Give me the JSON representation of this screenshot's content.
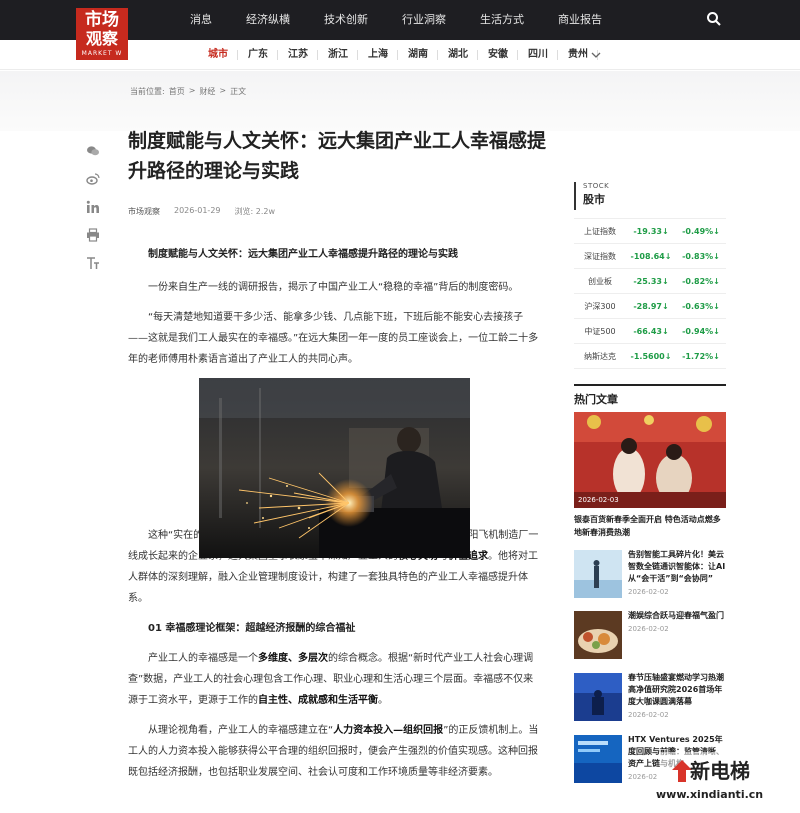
{
  "logo": {
    "line1": "市场",
    "line2": "观察",
    "line3": "MARKET W"
  },
  "topnav": [
    "消息",
    "经济纵横",
    "技术创新",
    "行业洞察",
    "生活方式",
    "商业报告"
  ],
  "cities": [
    "城市",
    "广东",
    "江苏",
    "浙江",
    "上海",
    "湖南",
    "湖北",
    "安徽",
    "四川",
    "贵州"
  ],
  "breadcrumb": {
    "prefix": "当前位置:",
    "home": "首页",
    "sep1": ">",
    "category": "财经",
    "sep2": ">",
    "current": "正文"
  },
  "article": {
    "title": "制度赋能与人文关怀：远大集团产业工人幸福感提升路径的理论与实践",
    "source": "市场观察",
    "date": "2026-01-29",
    "views": "浏览: 2.2w",
    "lead": "制度赋能与人文关怀：远大集团产业工人幸福感提升路径的理论与实践",
    "p1": "一份来自生产一线的调研报告，揭示了中国产业工人“稳稳的幸福”背后的制度密码。",
    "p2": "“每天清楚地知道要干多少活、能拿多少钱、几点能下班，下班后能不能安心去接孩子——这就是我们工人最实在的幸福感。”在远大集团一年一度的员工座谈会上，一位工龄二十多年的老师傅用朴素语言道出了产业工人的共同心声。",
    "p3_a": "这种“实在的幸福”，正是远大集团数千名产业工人的真实写照。作为从沈阳飞机制造厂一线成长起来的企业家，远大集团董事长康宝华深知产业工人的",
    "p3_b": "核心关切",
    "p3_c": "与",
    "p3_d": "价值追求",
    "p3_e": "。他将对工人群体的深刻理解，融入企业管理制度设计，构建了一套独具特色的产业工人幸福感提升体系。",
    "sub1": "01 幸福感理论框架：超越经济报酬的综合福祉",
    "p4_a": "产业工人的幸福感是一个",
    "p4_b": "多维度、多层次",
    "p4_c": "的综合概念。根据“新时代产业工人社会心理调查”数据，产业工人的社会心理包含工作心理、职业心理和生活心理三个层面。幸福感不仅来源于工资水平，更源于工作的",
    "p4_d": "自主性、成就感和生活平衡",
    "p4_e": "。",
    "p5_a": "从理论视角看，产业工人的幸福感建立在“",
    "p5_b": "人力资本投入—组织回报",
    "p5_c": "”的正反馈机制上。当工人的人力资本投入能够获得公平合理的组织回报时，便会产生强烈的价值实现感。这种回报既包括经济报酬，也包括职业发展空间、社会认可度和工作环境质量等非经济要素。"
  },
  "stock": {
    "label_en": "STOCK",
    "label_cn": "股市",
    "rows": [
      {
        "name": "上证指数",
        "change": "-19.33↓",
        "pct": "-0.49%↓"
      },
      {
        "name": "深证指数",
        "change": "-108.64↓",
        "pct": "-0.83%↓"
      },
      {
        "name": "创业板",
        "change": "-25.33↓",
        "pct": "-0.82%↓"
      },
      {
        "name": "沪深300",
        "change": "-28.97↓",
        "pct": "-0.63%↓"
      },
      {
        "name": "中证500",
        "change": "-66.43↓",
        "pct": "-0.94%↓"
      },
      {
        "name": "纳斯达克",
        "change": "-1.5600↓",
        "pct": "-1.72%↓"
      }
    ]
  },
  "hot": {
    "title": "热门文章",
    "hero_date": "2026-02-03",
    "hero_caption": "银泰百货新春季全面开启 特色活动点燃多地新春消费热潮",
    "items": [
      {
        "caption": "告别智能工具碎片化！美云智数全链通识智能体：让AI从“会干活”到“会协同”",
        "date": "2026-02-02"
      },
      {
        "caption": "潮娱综合跃马迎春福气盈门",
        "date": "2026-02-02"
      },
      {
        "caption": "春节压轴盛宴燃动学习热潮 高净值研究院2026首场年度大咖课圆满落幕",
        "date": "2026-02-02"
      },
      {
        "caption": "HTX Ventures 2025年度回顾与前瞻：监管清晰、资产上链与机构",
        "date": "2026-02"
      }
    ]
  },
  "watermark": {
    "brand": "新电梯",
    "url": "www.xindianti.cn"
  },
  "colors": {
    "nav_bg": "#1e1e22",
    "brand_red": "#c62a1e",
    "stock_green": "#1e9c46"
  }
}
